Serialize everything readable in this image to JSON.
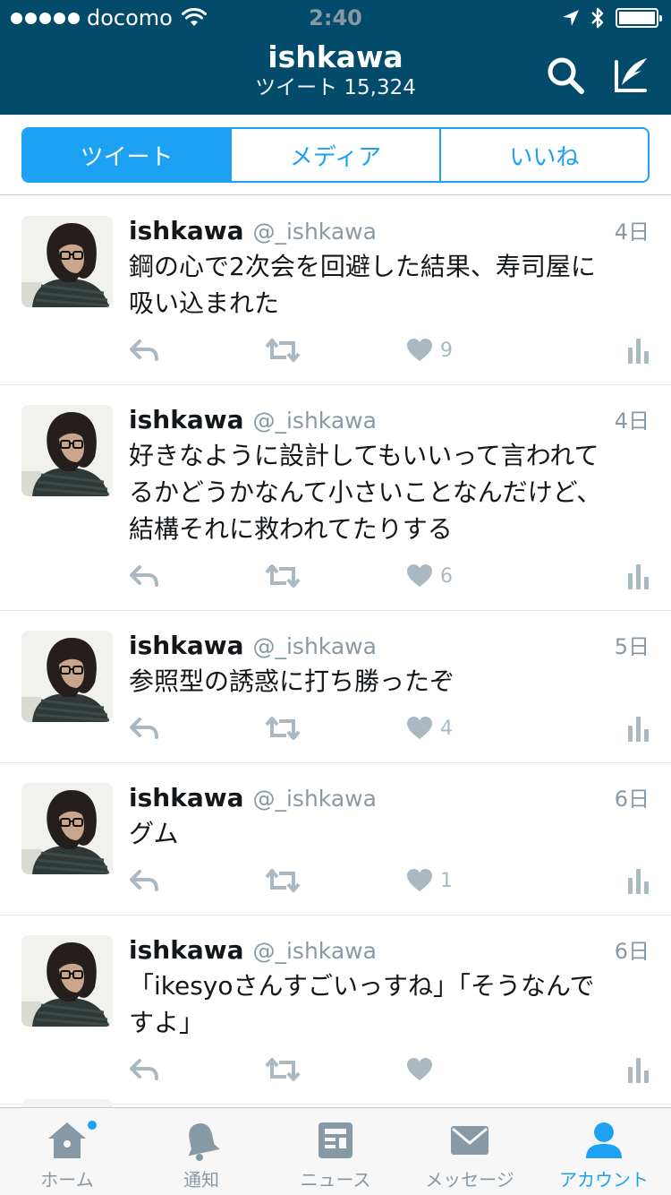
{
  "status_bar": {
    "carrier": "docomo",
    "time": "2:40"
  },
  "header": {
    "title": "ishkawa",
    "subtitle": "ツイート 15,324",
    "search_icon": "search-icon",
    "compose_icon": "compose-icon"
  },
  "tabs": [
    {
      "label": "ツイート",
      "active": true
    },
    {
      "label": "メディア",
      "active": false
    },
    {
      "label": "いいね",
      "active": false
    }
  ],
  "tweets": [
    {
      "name": "ishkawa",
      "handle": "@_ishkawa",
      "time": "4日",
      "lines": [
        "鋼の心で2次会を回避した結果、寿司屋に",
        "吸い込まれた"
      ],
      "likes": "9"
    },
    {
      "name": "ishkawa",
      "handle": "@_ishkawa",
      "time": "4日",
      "lines": [
        "好きなように設計してもいいって言われて",
        "るかどうかなんて小さいことなんだけど、",
        "結構それに救われてたりする"
      ],
      "likes": "6"
    },
    {
      "name": "ishkawa",
      "handle": "@_ishkawa",
      "time": "5日",
      "lines": [
        "参照型の誘惑に打ち勝ったぞ"
      ],
      "likes": "4"
    },
    {
      "name": "ishkawa",
      "handle": "@_ishkawa",
      "time": "6日",
      "lines": [
        "グム"
      ],
      "likes": "1"
    },
    {
      "name": "ishkawa",
      "handle": "@_ishkawa",
      "time": "6日",
      "lines": [
        "「ikesyoさんすごいっすね」「そうなんで",
        "すよ」"
      ],
      "likes": ""
    }
  ],
  "tab_bar": [
    {
      "label": "ホーム",
      "icon": "home-icon",
      "active": false,
      "badge": true
    },
    {
      "label": "通知",
      "icon": "bell-icon",
      "active": false,
      "badge": false
    },
    {
      "label": "ニュース",
      "icon": "news-icon",
      "active": false,
      "badge": false
    },
    {
      "label": "メッセージ",
      "icon": "mail-icon",
      "active": false,
      "badge": false
    },
    {
      "label": "アカウント",
      "icon": "person-icon",
      "active": true,
      "badge": false
    }
  ],
  "colors": {
    "header_bg": "#024b6b",
    "accent": "#1da1f2",
    "muted": "#8899a6",
    "action_icon": "#aab8c2"
  }
}
